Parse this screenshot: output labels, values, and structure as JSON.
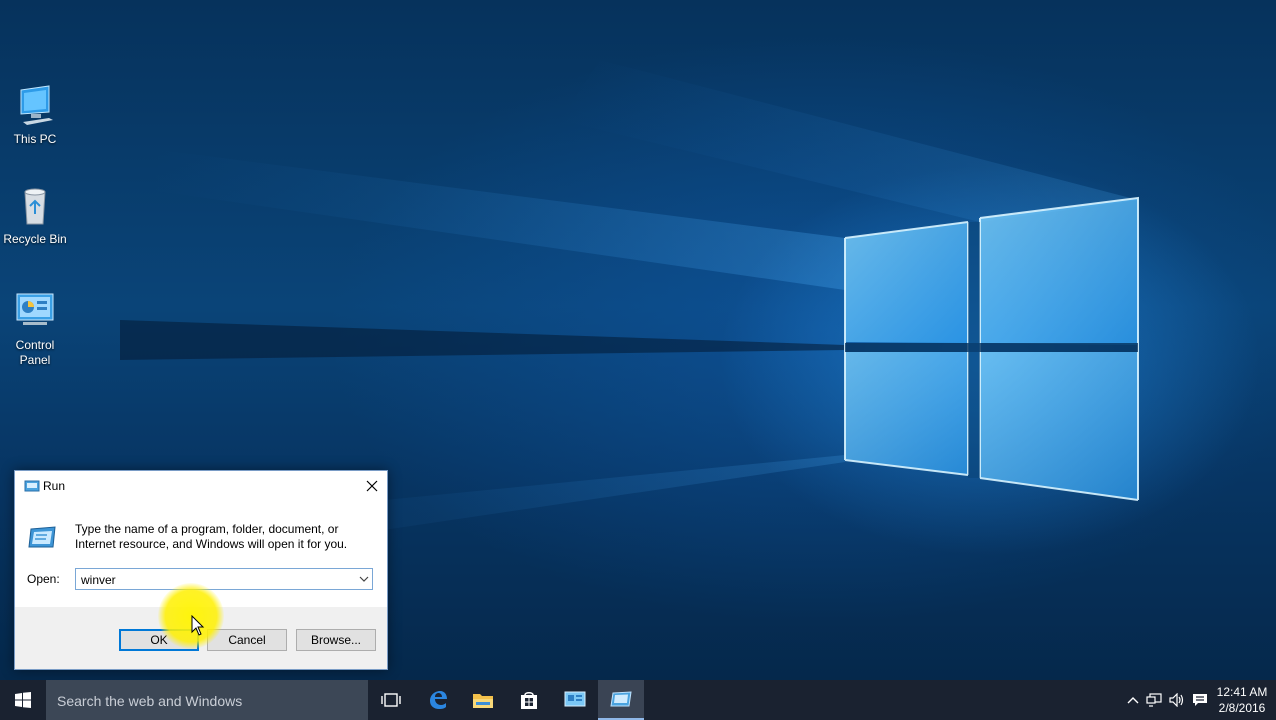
{
  "desktop": {
    "icons": [
      {
        "label": "This PC"
      },
      {
        "label": "Recycle Bin"
      },
      {
        "label": "Control Panel"
      }
    ]
  },
  "run_dialog": {
    "title": "Run",
    "description": "Type the name of a program, folder, document, or Internet resource, and Windows will open it for you.",
    "open_label": "Open:",
    "open_value": "winver",
    "ok_label": "OK",
    "cancel_label": "Cancel",
    "browse_label": "Browse..."
  },
  "taskbar": {
    "search_placeholder": "Search the web and Windows",
    "pinned": [
      "task-view-icon",
      "edge-icon",
      "file-explorer-icon",
      "store-icon",
      "control-panel-icon",
      "run-icon"
    ],
    "clock_time": "12:41 AM",
    "clock_date": "2/8/2016"
  },
  "colors": {
    "accent": "#0078d7",
    "taskbar": "#1a2230",
    "desktop": "#0a4478"
  }
}
